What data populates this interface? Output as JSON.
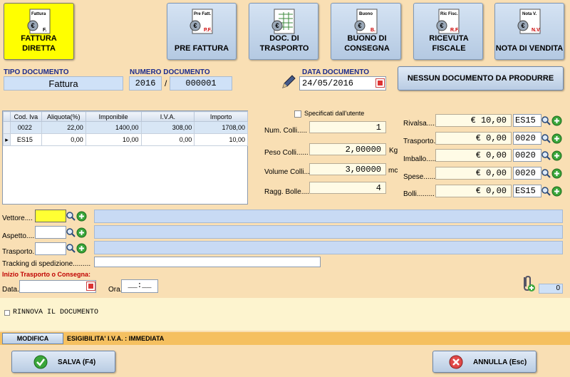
{
  "doc_buttons": [
    {
      "label": "FATTURA DIRETTA",
      "icon_text": "Fattura",
      "icon_tag": "F."
    },
    {
      "label": "PRE FATTURA",
      "icon_text": "Pre Fatt.",
      "icon_tag": "P.F."
    },
    {
      "label": "DOC. DI TRASPORTO",
      "icon_text": "",
      "icon_tag": ""
    },
    {
      "label": "BUONO DI CONSEGNA",
      "icon_text": "Buono",
      "icon_tag": "B."
    },
    {
      "label": "RICEVUTA FISCALE",
      "icon_text": "Ric Fisc.",
      "icon_tag": "R.F."
    },
    {
      "label": "NOTA DI VENDITA",
      "icon_text": "Nota V.",
      "icon_tag": "N.V."
    }
  ],
  "header": {
    "tipo_label": "TIPO DOCUMENTO",
    "tipo_value": "Fattura",
    "numero_label": "NUMERO DOCUMENTO",
    "anno": "2016",
    "separator": "/",
    "numero": "000001",
    "data_label": "DATA DOCUMENTO",
    "data_value": "24/05/2016",
    "nessun_label": "NESSUN DOCUMENTO DA PRODURRE"
  },
  "iva_table": {
    "columns": [
      "Cod. Iva",
      "Aliquota(%)",
      "Imponibile",
      "I.V.A.",
      "Importo"
    ],
    "rows": [
      [
        "0022",
        "22,00",
        "1400,00",
        "308,00",
        "1708,00"
      ],
      [
        "ES15",
        "0,00",
        "10,00",
        "0,00",
        "10,00"
      ]
    ]
  },
  "colli": {
    "specificati_label": "Specificati dall'utente",
    "num_colli_label": "Num. Colli.....",
    "num_colli": "1",
    "peso_label": "Peso Colli......",
    "peso": "2,00000",
    "peso_unit": "Kg",
    "volume_label": "Volume Colli....",
    "volume": "3,00000",
    "volume_unit": "mc",
    "ragg_label": "Ragg. Bolle.....",
    "ragg": "4"
  },
  "spese": [
    {
      "label": "Rivalsa.....",
      "value": "€ 10,00",
      "code": "ES15"
    },
    {
      "label": "Trasporto.",
      "value": "€ 0,00",
      "code": "0020"
    },
    {
      "label": "Imballo.....",
      "value": "€ 0,00",
      "code": "0020"
    },
    {
      "label": "Spese.......",
      "value": "€ 0,00",
      "code": "0020"
    },
    {
      "label": "Bolli.........",
      "value": "€ 0,00",
      "code": "ES15"
    }
  ],
  "trasporto": {
    "vettore_label": "Vettore....",
    "aspetto_label": "Aspetto.....",
    "trasporto_label": "Trasporto.",
    "tracking_label": "Tracking di spedizione.........",
    "inizio_label": "Inizio Trasporto o Consegna:",
    "data_label": "Data.",
    "ora_label": "Ora.",
    "ora_value": "__:__",
    "allegati_count": "0"
  },
  "rinnova_label": "RINNOVA IL DOCUMENTO",
  "footer": {
    "modifica_label": "MODIFICA",
    "esigibilita_text": "ESIGIBILITA' I.V.A. :  IMMEDIATA",
    "salva_label": "SALVA (F4)",
    "annulla_label": "ANNULLA (Esc)"
  },
  "colors": {
    "active_button": "#ffff00",
    "header_label": "#1c2c8c",
    "inizio_label": "#c00000"
  }
}
